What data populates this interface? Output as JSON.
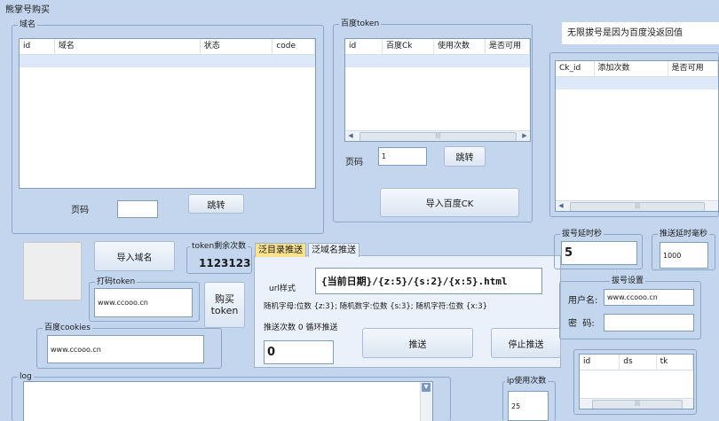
{
  "window": {
    "title": "熊掌号购买"
  },
  "domain_panel": {
    "legend": "域名",
    "columns": [
      "id",
      "域名",
      "状态",
      "code"
    ],
    "page_label": "页码",
    "page_value": "",
    "jump_label": "跳转"
  },
  "baidu_token_panel": {
    "legend": "百度token",
    "columns": [
      "id",
      "百度Ck",
      "使用次数",
      "是否可用"
    ],
    "page_label": "页码",
    "page_value": "1",
    "jump_label": "跳转",
    "import_label": "导入百度CK"
  },
  "notice": {
    "text": "无限拔号是因为百度没返回值"
  },
  "ck_panel": {
    "columns": [
      "Ck_id",
      "添加次数",
      "是否可用"
    ]
  },
  "import_domain": {
    "label": "导入域名"
  },
  "token_remaining": {
    "legend": "token剩余次数",
    "value": "1123123"
  },
  "dama_token": {
    "legend": "打码token",
    "value": "www.ccooo.cn"
  },
  "buy_token": {
    "label_line1": "购买",
    "label_line2": "token"
  },
  "baidu_cookies": {
    "legend": "百度cookies",
    "value": "www.ccooo.cn"
  },
  "push_panel": {
    "tabs": [
      "泛目录推送",
      "泛域名推送"
    ],
    "url_style_label": "url样式",
    "url_template": "{当前日期}/{z:5}/{s:2}/{x:5}.html",
    "random_hint": "随机字母:位数 {z:3}; 随机数字:位数 {s:3}; 随机字符:位数 {x:3}",
    "push_count_label": "推送次数 0 循环推送",
    "push_count_value": "0",
    "push_button": "推送",
    "stop_button": "停止推送"
  },
  "dial_delay": {
    "legend": "拔号延时秒",
    "value": "5"
  },
  "push_delay": {
    "legend": "推送延时毫秒",
    "value": "1000"
  },
  "dial_settings": {
    "legend": "拔号设置",
    "username_label": "用户名:",
    "username_value": "www.ccooo.cn",
    "password_label": "密  码:",
    "password_value": ""
  },
  "log": {
    "legend": "log"
  },
  "ip_usage": {
    "legend": "ip使用次数",
    "value": "25"
  },
  "ip_table": {
    "columns": [
      "id",
      "ds",
      "tk"
    ]
  }
}
